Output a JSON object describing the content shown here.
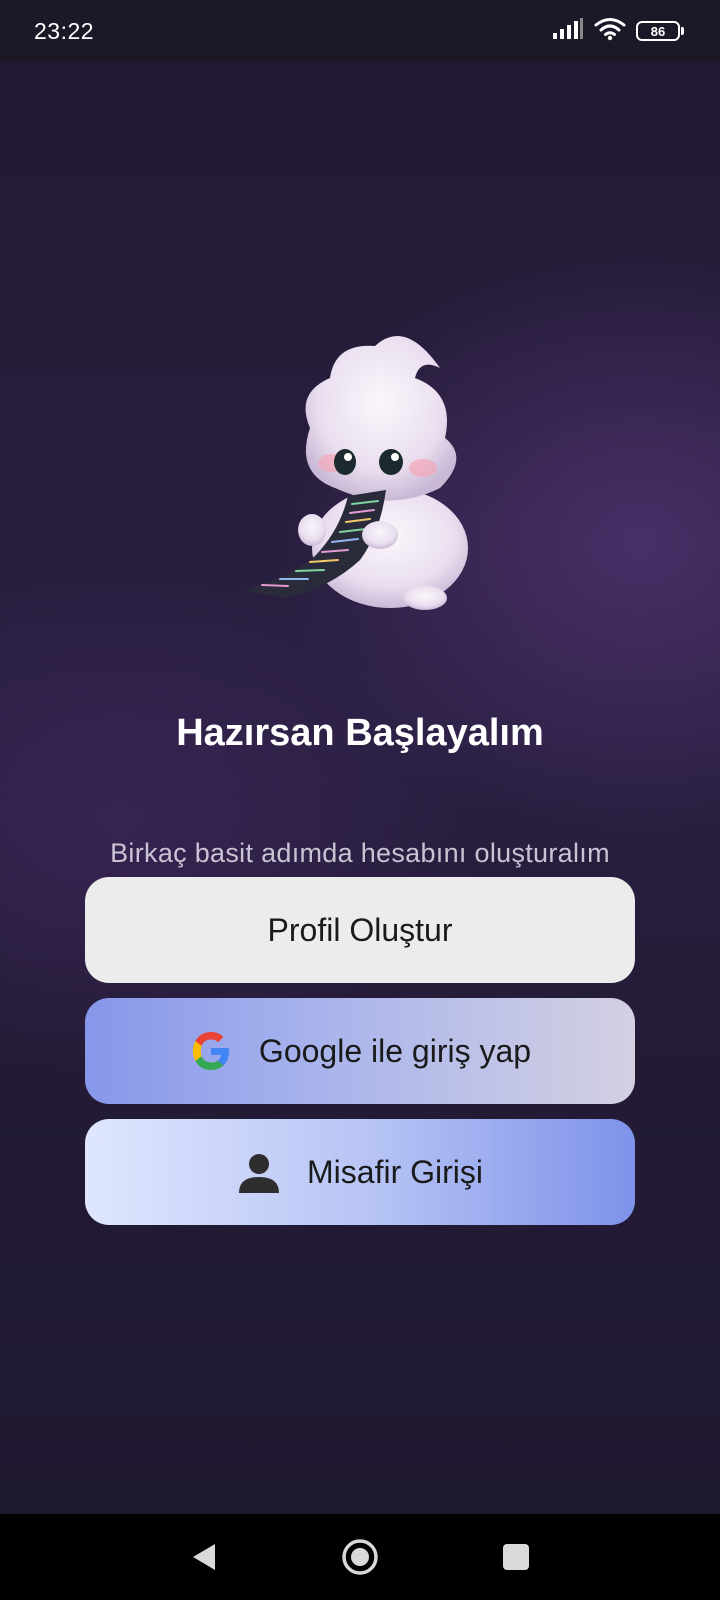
{
  "status_bar": {
    "time": "23:22",
    "battery": "86",
    "icons": [
      "signal-icon",
      "wifi-icon",
      "battery-icon"
    ]
  },
  "main": {
    "mascot": "cloud-mascot-illustration",
    "title": "Hazırsan Başlayalım",
    "subtitle": "Birkaç basit adımda hesabını oluşturalım"
  },
  "buttons": {
    "profile": {
      "label": "Profil Oluştur"
    },
    "google": {
      "label": "Google ile giriş yap",
      "icon": "google-icon"
    },
    "guest": {
      "label": "Misafir Girişi",
      "icon": "person-icon"
    }
  },
  "nav_bar": {
    "icons": [
      "back-icon",
      "home-icon",
      "recents-icon"
    ]
  },
  "colors": {
    "background": "#241c38",
    "title": "#ffffff",
    "subtitle": "#c9c3d4",
    "profile_button": "#ececec",
    "google_button_start": "#8797ea",
    "guest_button_end": "#7f92ea"
  }
}
